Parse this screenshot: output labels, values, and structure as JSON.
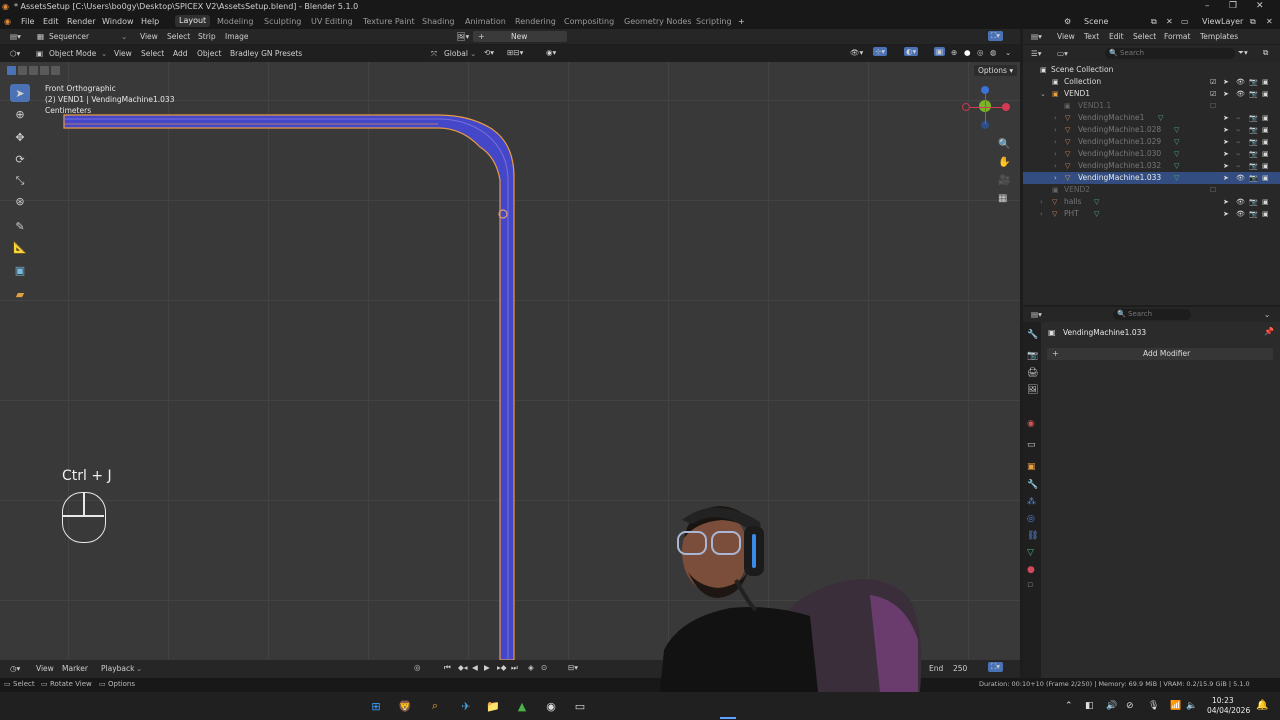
{
  "window": {
    "title": "* AssetsSetup [C:\\Users\\bo0gy\\Desktop\\SPICEX V2\\AssetsSetup.blend] - Blender 5.1.0"
  },
  "menu": [
    "File",
    "Edit",
    "Render",
    "Window",
    "Help"
  ],
  "workspaces": [
    "Layout",
    "Modeling",
    "Sculpting",
    "UV Editing",
    "Texture Paint",
    "Shading",
    "Animation",
    "Rendering",
    "Compositing",
    "Geometry Nodes",
    "Scripting"
  ],
  "active_workspace": "Layout",
  "scene": {
    "scene_name": "Scene",
    "view_layer": "ViewLayer"
  },
  "sequencer_header": {
    "editor": "Sequencer",
    "menus": [
      "View",
      "Select",
      "Strip",
      "Image"
    ],
    "new_label": "New"
  },
  "viewport_header": {
    "mode": "Object Mode",
    "menus": [
      "View",
      "Select",
      "Add",
      "Object",
      "Bradley GN Presets"
    ],
    "orientation": "Global",
    "options_label": "Options"
  },
  "viewport": {
    "view_name": "Front Orthographic",
    "context": "(2) VEND1 | VendingMachine1.033",
    "units": "Centimeters",
    "shortcut_overlay": "Ctrl + J"
  },
  "text_editor_header": {
    "menus": [
      "View",
      "Text",
      "Edit",
      "Select",
      "Format",
      "Templates"
    ]
  },
  "outliner": {
    "search_placeholder": "Search",
    "rows": [
      {
        "label": "Scene Collection",
        "kind": "scene"
      },
      {
        "label": "Collection",
        "kind": "collection"
      },
      {
        "label": "VEND1",
        "kind": "collection"
      },
      {
        "label": "VEND1.1",
        "kind": "collection-dim"
      },
      {
        "label": "VendingMachine1",
        "kind": "object"
      },
      {
        "label": "VendingMachine1.028",
        "kind": "object"
      },
      {
        "label": "VendingMachine1.029",
        "kind": "object"
      },
      {
        "label": "VendingMachine1.030",
        "kind": "object"
      },
      {
        "label": "VendingMachine1.032",
        "kind": "object"
      },
      {
        "label": "VendingMachine1.033",
        "kind": "object-selected"
      },
      {
        "label": "VEND2",
        "kind": "collection-dim"
      },
      {
        "label": "halls",
        "kind": "object"
      },
      {
        "label": "PHT",
        "kind": "object"
      }
    ]
  },
  "properties": {
    "search_placeholder": "Search",
    "object_name": "VendingMachine1.033",
    "add_modifier_label": "Add Modifier"
  },
  "timeline": {
    "menus": [
      "View",
      "Marker",
      "Playback"
    ],
    "end_label": "End",
    "end_value": "250"
  },
  "statusbar": {
    "hints": [
      "Select",
      "Rotate View",
      "Options"
    ],
    "info": "Duration: 00:10+10 (Frame 2/250) | Memory: 69.9 MiB | VRAM: 0.2/15.9 GiB | 5.1.0"
  },
  "taskbar": {
    "time": "10:23",
    "date": "04/04/2026"
  },
  "colors": {
    "selection": "#334d80",
    "mesh_fill": "#4447c8",
    "mesh_outline": "#e89a45",
    "viewport_bg": "#393939"
  }
}
